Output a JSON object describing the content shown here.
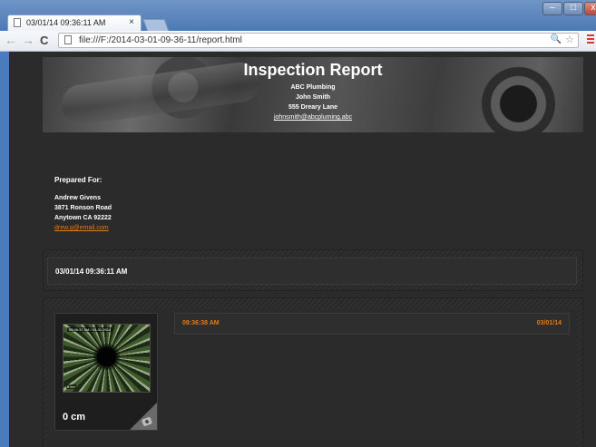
{
  "browser": {
    "tab_title": "03/01/14 09:36:11 AM",
    "tab_close": "×",
    "url": "file:///F:/2014-03-01-09-36-11/report.html",
    "window_buttons": {
      "minimize": "–",
      "maximize": "□",
      "close": "x"
    },
    "nav": {
      "back": "←",
      "forward": "→",
      "reload": "C"
    },
    "icons": {
      "zoom": "🔍",
      "star": "☆"
    }
  },
  "header": {
    "title": "Inspection Report",
    "company": "ABC Plumbing",
    "contact_name": "John Smith",
    "address": "555 Dreary Lane",
    "email": "johnsmith@abcpluming.abc"
  },
  "client": {
    "heading": "Prepared For:",
    "name": "Andrew Givens",
    "street": "3871 Ronson Road",
    "city": "Anytown CA 92222",
    "email": "drew.g@email.com"
  },
  "session": {
    "label": "03/01/14 09:36:11 AM"
  },
  "observation": {
    "thumbnail_overlay": "09:36:37 AM / 03-01-2014",
    "thumbnail_corner": "0 cm",
    "distance": "0 cm",
    "time": "09:36:38 AM",
    "date": "03/01/14"
  },
  "colors": {
    "accent": "#e07b18",
    "page_background": "#2b2b2b",
    "window_frame": "#4a7bbd"
  }
}
